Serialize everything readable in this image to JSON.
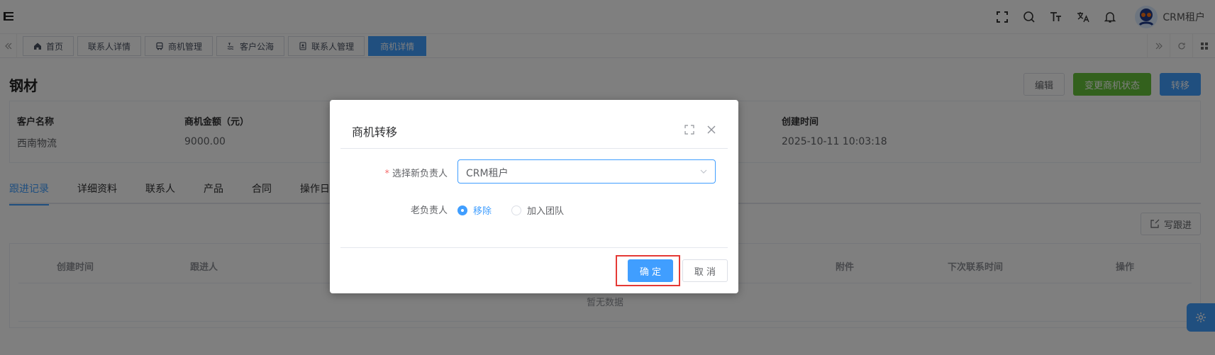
{
  "tags": [
    {
      "label": "首页",
      "icon": "home-icon",
      "active": false
    },
    {
      "label": "联系人详情",
      "icon": "",
      "active": false
    },
    {
      "label": "商机管理",
      "icon": "bus-icon",
      "active": false
    },
    {
      "label": "客户公海",
      "icon": "sea-icon",
      "active": false
    },
    {
      "label": "联系人管理",
      "icon": "contact-icon",
      "active": false
    },
    {
      "label": "商机详情",
      "icon": "",
      "active": true
    }
  ],
  "user": {
    "name": "CRM租户"
  },
  "page": {
    "title": "钢材"
  },
  "actions": {
    "edit": "编辑",
    "change_status": "变更商机状态",
    "transfer": "转移"
  },
  "info": [
    {
      "label": "客户名称",
      "value": "西南物流"
    },
    {
      "label": "商机金额（元）",
      "value": "9000.00"
    },
    {
      "label": "创建时间",
      "value": "2025-10-11 10:03:18"
    }
  ],
  "tabs": [
    "跟进记录",
    "详细资料",
    "联系人",
    "产品",
    "合同",
    "操作日"
  ],
  "write_followup": "写跟进",
  "table": {
    "headers": [
      "创建时间",
      "跟进人",
      "附件",
      "下次联系时间",
      "操作"
    ],
    "empty": "暂无数据"
  },
  "dialog": {
    "title": "商机转移",
    "owner_label": "选择新负责人",
    "owner_value": "CRM租户",
    "old_owner_label": "老负责人",
    "options": [
      "移除",
      "加入团队"
    ],
    "selected": 0,
    "confirm": "确 定",
    "cancel": "取 消"
  },
  "colors": {
    "primary": "#409eff",
    "success": "#67c23a",
    "highlight": "#e53935"
  }
}
